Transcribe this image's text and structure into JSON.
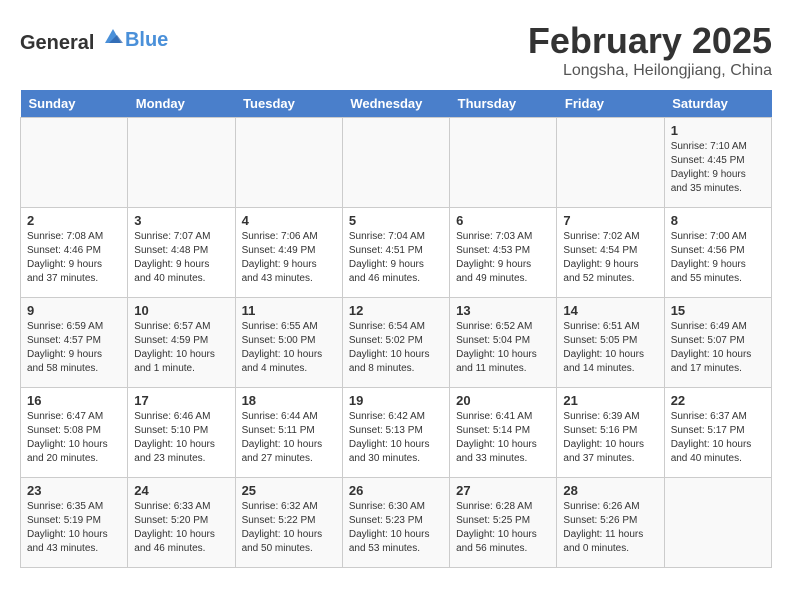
{
  "header": {
    "logo_general": "General",
    "logo_blue": "Blue",
    "title": "February 2025",
    "subtitle": "Longsha, Heilongjiang, China"
  },
  "calendar": {
    "weekdays": [
      "Sunday",
      "Monday",
      "Tuesday",
      "Wednesday",
      "Thursday",
      "Friday",
      "Saturday"
    ],
    "weeks": [
      [
        {
          "day": "",
          "info": ""
        },
        {
          "day": "",
          "info": ""
        },
        {
          "day": "",
          "info": ""
        },
        {
          "day": "",
          "info": ""
        },
        {
          "day": "",
          "info": ""
        },
        {
          "day": "",
          "info": ""
        },
        {
          "day": "1",
          "info": "Sunrise: 7:10 AM\nSunset: 4:45 PM\nDaylight: 9 hours and 35 minutes."
        }
      ],
      [
        {
          "day": "2",
          "info": "Sunrise: 7:08 AM\nSunset: 4:46 PM\nDaylight: 9 hours and 37 minutes."
        },
        {
          "day": "3",
          "info": "Sunrise: 7:07 AM\nSunset: 4:48 PM\nDaylight: 9 hours and 40 minutes."
        },
        {
          "day": "4",
          "info": "Sunrise: 7:06 AM\nSunset: 4:49 PM\nDaylight: 9 hours and 43 minutes."
        },
        {
          "day": "5",
          "info": "Sunrise: 7:04 AM\nSunset: 4:51 PM\nDaylight: 9 hours and 46 minutes."
        },
        {
          "day": "6",
          "info": "Sunrise: 7:03 AM\nSunset: 4:53 PM\nDaylight: 9 hours and 49 minutes."
        },
        {
          "day": "7",
          "info": "Sunrise: 7:02 AM\nSunset: 4:54 PM\nDaylight: 9 hours and 52 minutes."
        },
        {
          "day": "8",
          "info": "Sunrise: 7:00 AM\nSunset: 4:56 PM\nDaylight: 9 hours and 55 minutes."
        }
      ],
      [
        {
          "day": "9",
          "info": "Sunrise: 6:59 AM\nSunset: 4:57 PM\nDaylight: 9 hours and 58 minutes."
        },
        {
          "day": "10",
          "info": "Sunrise: 6:57 AM\nSunset: 4:59 PM\nDaylight: 10 hours and 1 minute."
        },
        {
          "day": "11",
          "info": "Sunrise: 6:55 AM\nSunset: 5:00 PM\nDaylight: 10 hours and 4 minutes."
        },
        {
          "day": "12",
          "info": "Sunrise: 6:54 AM\nSunset: 5:02 PM\nDaylight: 10 hours and 8 minutes."
        },
        {
          "day": "13",
          "info": "Sunrise: 6:52 AM\nSunset: 5:04 PM\nDaylight: 10 hours and 11 minutes."
        },
        {
          "day": "14",
          "info": "Sunrise: 6:51 AM\nSunset: 5:05 PM\nDaylight: 10 hours and 14 minutes."
        },
        {
          "day": "15",
          "info": "Sunrise: 6:49 AM\nSunset: 5:07 PM\nDaylight: 10 hours and 17 minutes."
        }
      ],
      [
        {
          "day": "16",
          "info": "Sunrise: 6:47 AM\nSunset: 5:08 PM\nDaylight: 10 hours and 20 minutes."
        },
        {
          "day": "17",
          "info": "Sunrise: 6:46 AM\nSunset: 5:10 PM\nDaylight: 10 hours and 23 minutes."
        },
        {
          "day": "18",
          "info": "Sunrise: 6:44 AM\nSunset: 5:11 PM\nDaylight: 10 hours and 27 minutes."
        },
        {
          "day": "19",
          "info": "Sunrise: 6:42 AM\nSunset: 5:13 PM\nDaylight: 10 hours and 30 minutes."
        },
        {
          "day": "20",
          "info": "Sunrise: 6:41 AM\nSunset: 5:14 PM\nDaylight: 10 hours and 33 minutes."
        },
        {
          "day": "21",
          "info": "Sunrise: 6:39 AM\nSunset: 5:16 PM\nDaylight: 10 hours and 37 minutes."
        },
        {
          "day": "22",
          "info": "Sunrise: 6:37 AM\nSunset: 5:17 PM\nDaylight: 10 hours and 40 minutes."
        }
      ],
      [
        {
          "day": "23",
          "info": "Sunrise: 6:35 AM\nSunset: 5:19 PM\nDaylight: 10 hours and 43 minutes."
        },
        {
          "day": "24",
          "info": "Sunrise: 6:33 AM\nSunset: 5:20 PM\nDaylight: 10 hours and 46 minutes."
        },
        {
          "day": "25",
          "info": "Sunrise: 6:32 AM\nSunset: 5:22 PM\nDaylight: 10 hours and 50 minutes."
        },
        {
          "day": "26",
          "info": "Sunrise: 6:30 AM\nSunset: 5:23 PM\nDaylight: 10 hours and 53 minutes."
        },
        {
          "day": "27",
          "info": "Sunrise: 6:28 AM\nSunset: 5:25 PM\nDaylight: 10 hours and 56 minutes."
        },
        {
          "day": "28",
          "info": "Sunrise: 6:26 AM\nSunset: 5:26 PM\nDaylight: 11 hours and 0 minutes."
        },
        {
          "day": "",
          "info": ""
        }
      ]
    ]
  }
}
